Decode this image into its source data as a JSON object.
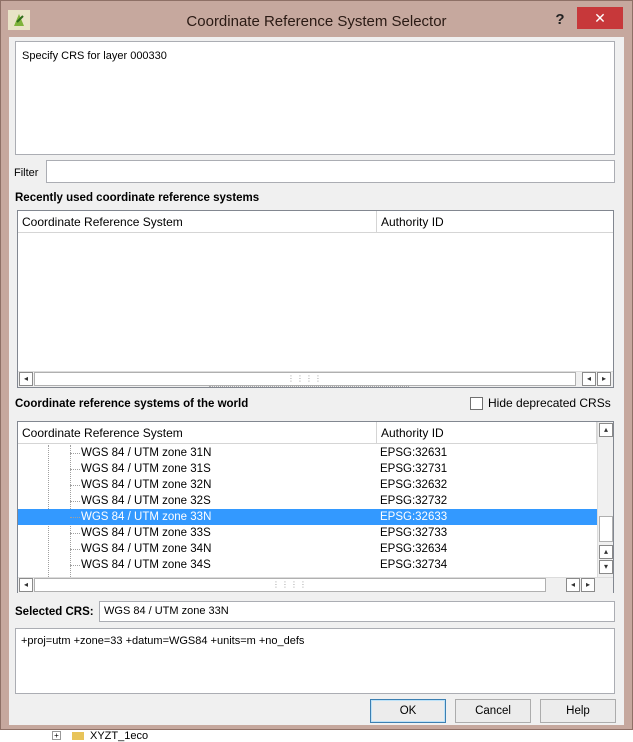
{
  "window": {
    "title": "Coordinate Reference System Selector",
    "help_glyph": "?",
    "close_glyph": "✕"
  },
  "description": "Specify CRS for layer 000330",
  "filter": {
    "label": "Filter",
    "value": ""
  },
  "recent": {
    "heading": "Recently used coordinate reference systems",
    "columns": [
      "Coordinate Reference System",
      "Authority ID"
    ],
    "rows": []
  },
  "world": {
    "heading": "Coordinate reference systems of the world",
    "hide_deprecated_label": "Hide deprecated CRSs",
    "hide_deprecated_checked": false,
    "columns": [
      "Coordinate Reference System",
      "Authority ID"
    ],
    "rows": [
      {
        "crs": "WGS 84 / UTM zone 31N",
        "auth": "EPSG:32631",
        "selected": false
      },
      {
        "crs": "WGS 84 / UTM zone 31S",
        "auth": "EPSG:32731",
        "selected": false
      },
      {
        "crs": "WGS 84 / UTM zone 32N",
        "auth": "EPSG:32632",
        "selected": false
      },
      {
        "crs": "WGS 84 / UTM zone 32S",
        "auth": "EPSG:32732",
        "selected": false
      },
      {
        "crs": "WGS 84 / UTM zone 33N",
        "auth": "EPSG:32633",
        "selected": true
      },
      {
        "crs": "WGS 84 / UTM zone 33S",
        "auth": "EPSG:32733",
        "selected": false
      },
      {
        "crs": "WGS 84 / UTM zone 34N",
        "auth": "EPSG:32634",
        "selected": false
      },
      {
        "crs": "WGS 84 / UTM zone 34S",
        "auth": "EPSG:32734",
        "selected": false
      }
    ]
  },
  "selected_crs": {
    "label": "Selected CRS:",
    "value": "WGS 84 / UTM zone 33N"
  },
  "proj_string": "+proj=utm +zone=33 +datum=WGS84 +units=m +no_defs",
  "buttons": {
    "ok": "OK",
    "cancel": "Cancel",
    "help": "Help"
  },
  "background": {
    "layer_label": "XYZT_1eco"
  },
  "colors": {
    "selection": "#3399ff",
    "frame": "#c6a89e",
    "close": "#c7383a"
  }
}
